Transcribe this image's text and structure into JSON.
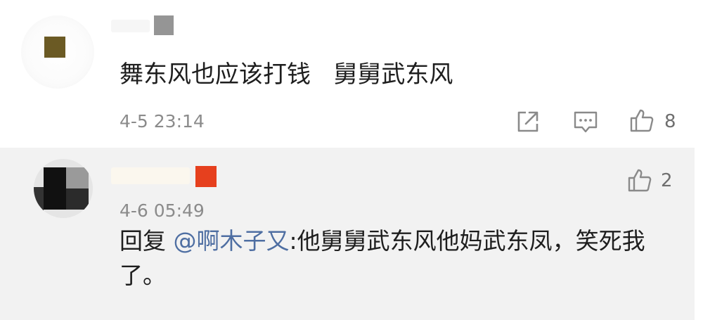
{
  "comment": {
    "text": "舞东风也应该打钱   舅舅武东风",
    "timestamp": "4-5 23:14",
    "like_count": "8",
    "icons": [
      "share-icon",
      "reply-icon",
      "like-icon"
    ]
  },
  "reply": {
    "timestamp": "4-6 05:49",
    "like_count": "2",
    "prefix": "回复 ",
    "mention": "@啊木子又",
    "body": ":他舅舅武东风他妈武东凤，笑死我了。",
    "icons": [
      "like-icon"
    ]
  },
  "colors": {
    "reply_background": "#f2f2f2",
    "mention_link": "#4e6ea2",
    "badge_red": "#e6401e",
    "secondary_text": "#8b8b8b"
  }
}
